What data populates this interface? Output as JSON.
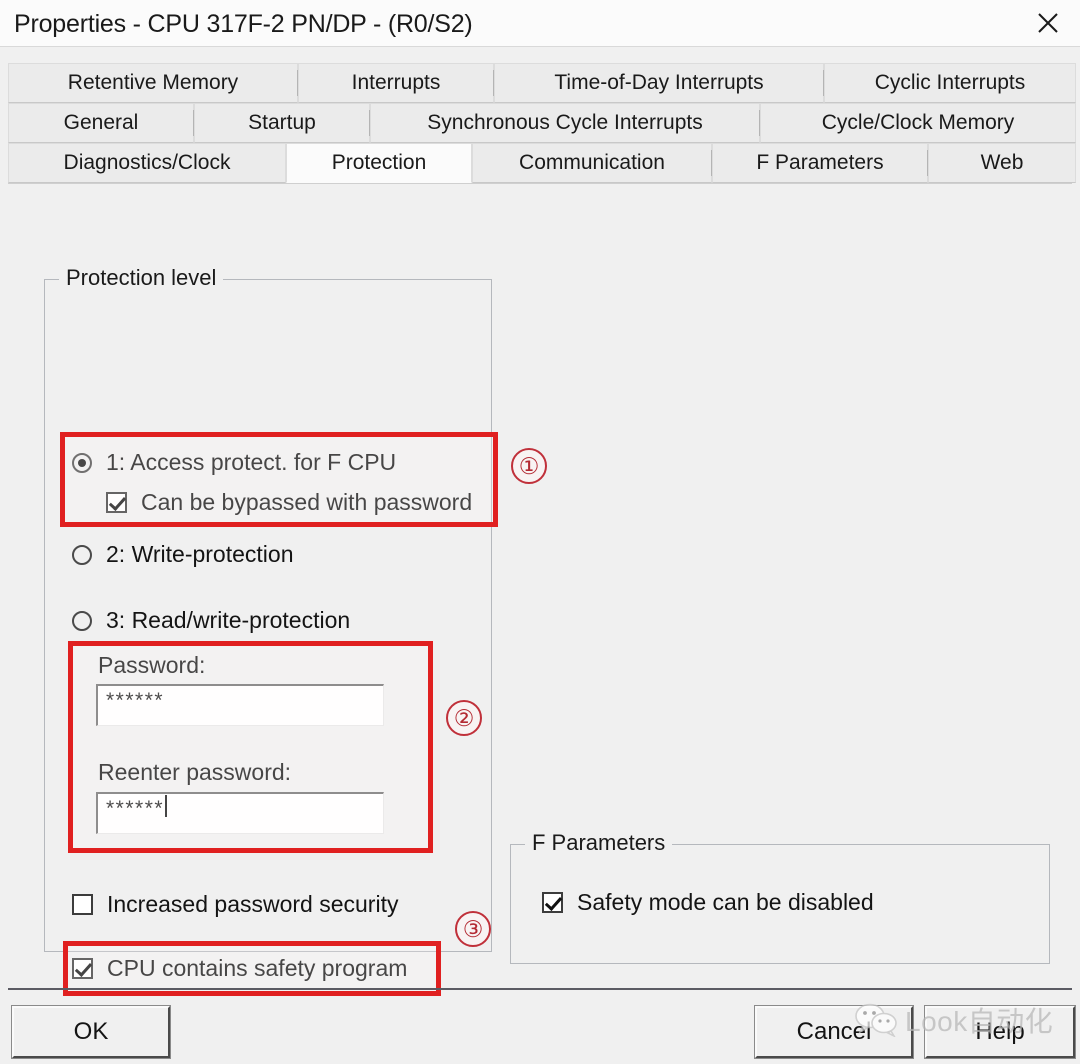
{
  "window": {
    "title": "Properties - CPU 317F-2 PN/DP - (R0/S2)",
    "close_icon": "close-icon"
  },
  "tabs": {
    "selected": "Protection",
    "rows": [
      [
        {
          "label": "Retentive Memory"
        },
        {
          "label": "Interrupts"
        },
        {
          "label": "Time-of-Day Interrupts"
        },
        {
          "label": "Cyclic Interrupts"
        }
      ],
      [
        {
          "label": "General"
        },
        {
          "label": "Startup"
        },
        {
          "label": "Synchronous Cycle Interrupts"
        },
        {
          "label": "Cycle/Clock Memory"
        }
      ],
      [
        {
          "label": "Diagnostics/Clock"
        },
        {
          "label": "Protection"
        },
        {
          "label": "Communication"
        },
        {
          "label": "F Parameters"
        },
        {
          "label": "Web"
        }
      ]
    ]
  },
  "protection_group": {
    "title": "Protection level",
    "levels": [
      {
        "label": "1: Access protect. for F CPU",
        "checked": true
      },
      {
        "label": "2: Write-protection",
        "checked": false
      },
      {
        "label": "3: Read/write-protection",
        "checked": false
      }
    ],
    "bypass_checkbox": {
      "label": "Can be bypassed with password",
      "checked": true
    },
    "password": {
      "label": "Password:",
      "value": "******",
      "placeholder": ""
    },
    "reenter_password": {
      "label": "Reenter password:",
      "value": "******",
      "placeholder": ""
    },
    "increased_security": {
      "label": "Increased password security",
      "checked": false
    },
    "safety_program": {
      "label": "CPU contains safety program",
      "checked": true
    }
  },
  "f_parameters_group": {
    "title": "F Parameters",
    "safety_mode": {
      "label": "Safety mode can be disabled",
      "checked": true
    }
  },
  "footer": {
    "ok_label": "OK",
    "cancel_label": "Cancel",
    "help_label": "Help"
  },
  "watermark": {
    "text": "Look自动化",
    "logo_icon": "wechat-logo-icon"
  },
  "annotations": [
    {
      "marker": "①",
      "target": "protection-level-1"
    },
    {
      "marker": "②",
      "target": "password-fields"
    },
    {
      "marker": "③",
      "target": "cpu-contains-safety-program"
    }
  ],
  "colors": {
    "annotation_red": "#e02020",
    "window_bg": "#f0f0f0",
    "tab_selected_bg": "#fbfbfb"
  }
}
